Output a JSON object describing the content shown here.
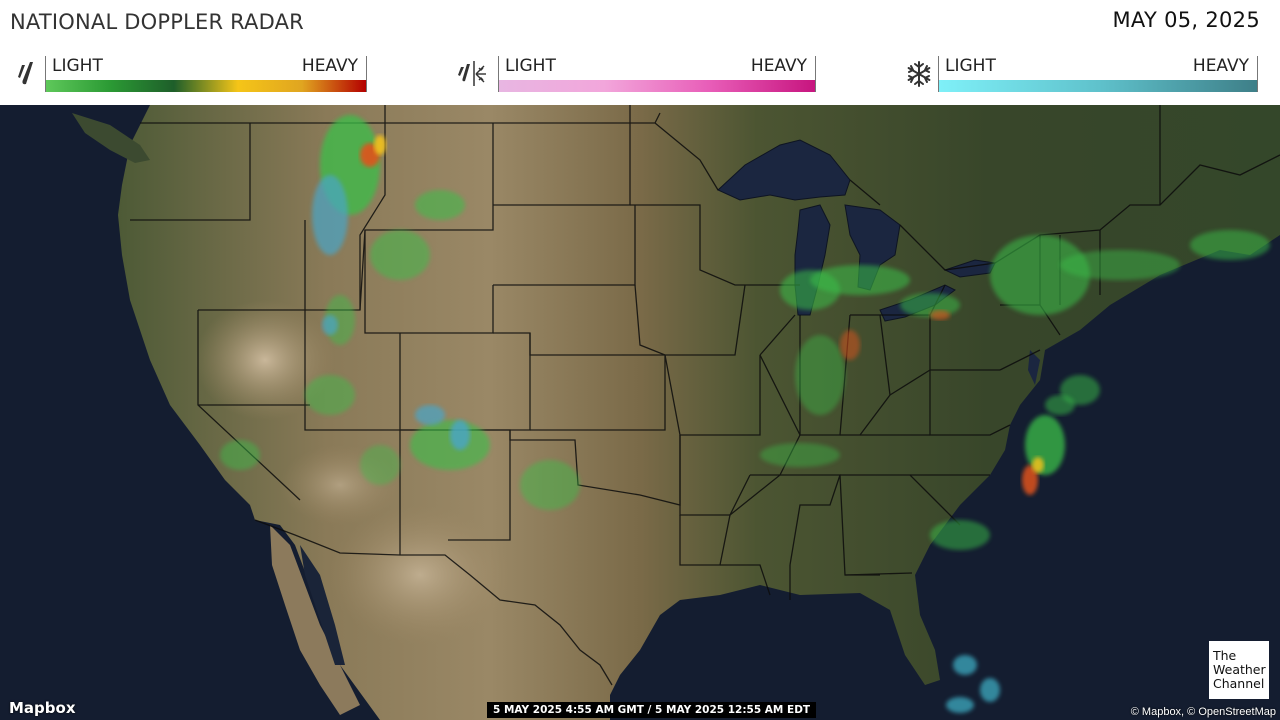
{
  "header": {
    "title": "NATIONAL DOPPLER RADAR",
    "date": "MAY 05, 2025"
  },
  "legends": [
    {
      "type": "rain",
      "icon": "rain-drops-icon",
      "light_label": "LIGHT",
      "heavy_label": "HEAVY",
      "gradient": [
        "#5ec85a",
        "#2b9a34",
        "#1e5e2a",
        "#f5c518",
        "#e0a520",
        "#b40000"
      ]
    },
    {
      "type": "mix",
      "icon": "rain-snow-mix-icon",
      "light_label": "LIGHT",
      "heavy_label": "HEAVY",
      "gradient": [
        "#e8b6e2",
        "#f2a6db",
        "#e85db8",
        "#c7157f"
      ]
    },
    {
      "type": "snow",
      "icon": "snowflake-icon",
      "light_label": "LIGHT",
      "heavy_label": "HEAVY",
      "gradient": [
        "#7ff0f8",
        "#5fc2cc",
        "#3e7f88"
      ]
    }
  ],
  "map": {
    "provider_logo": "Mapbox",
    "timestamp": "5 MAY 2025 4:55 AM GMT / 5 MAY 2025 12:55 AM EDT",
    "brand_logo_lines": [
      "The",
      "Weather",
      "Channel"
    ],
    "attribution": "© Mapbox, © OpenStreetMap",
    "colors": {
      "ocean": "#141d30",
      "land_west": "#7a6a4c",
      "land_east": "#3a4a28",
      "lakes": "#1b2640",
      "borders": "#111111"
    }
  }
}
